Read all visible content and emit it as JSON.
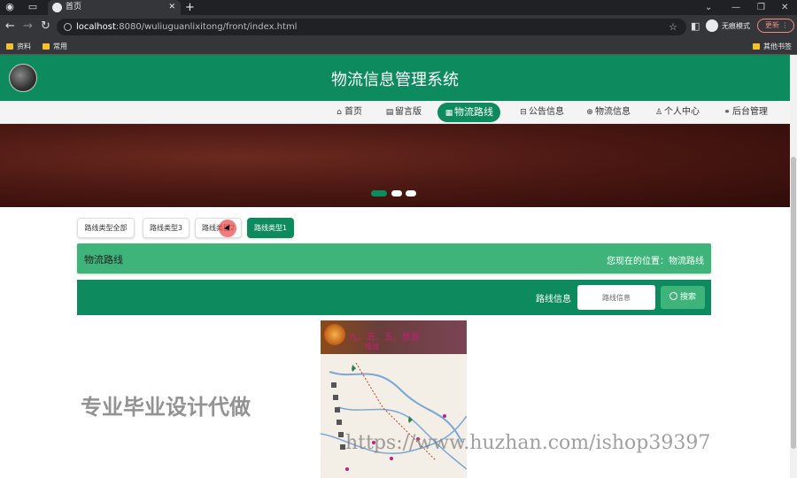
{
  "browser": {
    "tab_title": "首页",
    "url_host": "localhost",
    "url_rest": ":8080/wuliuguanlixitong/front/index.html",
    "incognito_label": "无痕模式",
    "update_label": "更新",
    "bookmarks": [
      {
        "label": "资料"
      },
      {
        "label": "常用"
      },
      {
        "label": "其他书签"
      }
    ]
  },
  "site": {
    "title": "物流信息管理系统",
    "nav": [
      {
        "label": "首页",
        "icon": "home-icon"
      },
      {
        "label": "留言版",
        "icon": "message-icon"
      },
      {
        "label": "物流路线",
        "icon": "route-icon",
        "active": true
      },
      {
        "label": "公告信息",
        "icon": "notice-icon"
      },
      {
        "label": "物流信息",
        "icon": "globe-icon"
      },
      {
        "label": "个人中心",
        "icon": "user-icon"
      },
      {
        "label": "后台管理",
        "icon": "link-icon"
      }
    ]
  },
  "carousel": {
    "dots": 3,
    "active_index": 0
  },
  "filters": [
    {
      "label": "路线类型全部"
    },
    {
      "label": "路线类型3"
    },
    {
      "label": "路线类型2"
    },
    {
      "label": "路线类型1",
      "active": true
    }
  ],
  "section": {
    "title": "物流路线",
    "location": "您现在的位置：物流路线"
  },
  "search": {
    "label": "路线信息",
    "placeholder": "路线信息",
    "button_label": "搜索"
  },
  "card": {
    "image_text_1": "九、五、五、旅游",
    "image_text_2": "路线",
    "image_label": "路线信息图"
  },
  "watermarks": {
    "text_1": "专业毕业设计代做",
    "text_2": "https://www.huzhan.com/ishop39397"
  },
  "colors": {
    "primary": "#0e8a5f",
    "secondary": "#3fb47a"
  }
}
